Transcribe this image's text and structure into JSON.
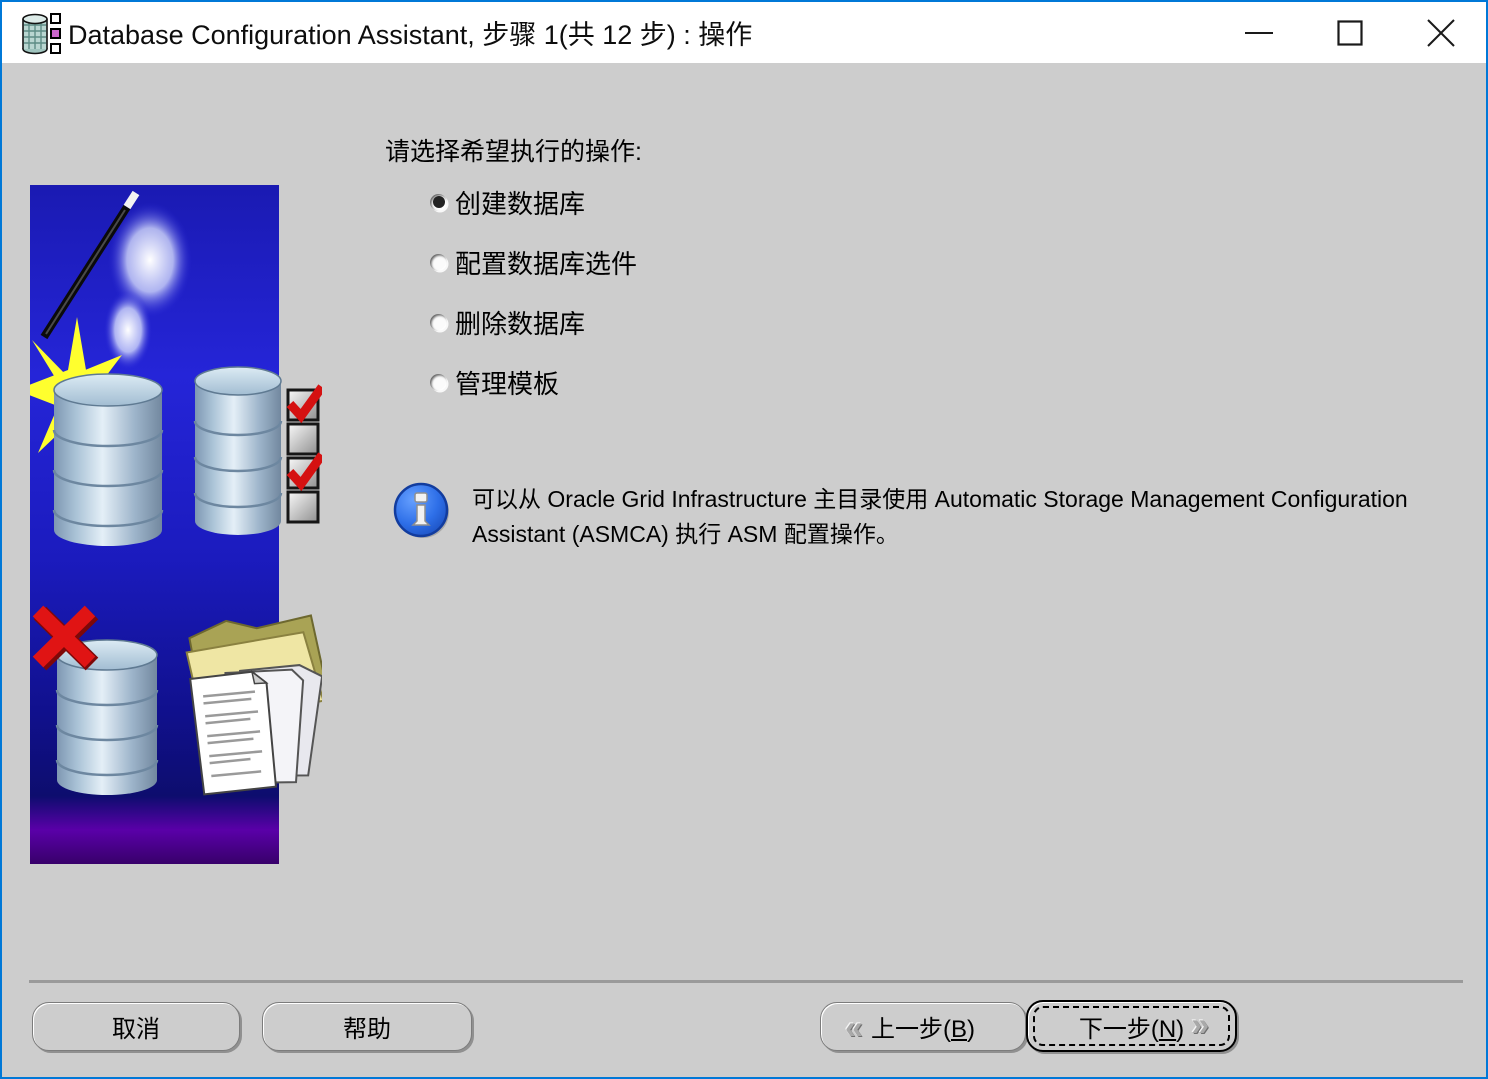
{
  "window": {
    "title": "Database Configuration Assistant, 步骤 1(共 12 步) : 操作",
    "accent_border_color": "#0078d7",
    "background_color": "#cdcdcd",
    "icons": {
      "app_icon": "database-cylinder-with-squares",
      "minimize": "minimize-dash",
      "maximize": "maximize-square",
      "close": "close-x"
    }
  },
  "main": {
    "prompt": "请选择希望执行的操作:",
    "options": [
      {
        "label": "创建数据库",
        "selected": true
      },
      {
        "label": "配置数据库选件",
        "selected": false
      },
      {
        "label": "删除数据库",
        "selected": false
      },
      {
        "label": "管理模板",
        "selected": false
      }
    ],
    "info": {
      "icon": "info-icon",
      "lines": [
        "可以从 Oracle Grid Infrastructure 主目录使用 Automatic Storage Management Configuration",
        "Assistant (ASMCA) 执行 ASM 配置操作。"
      ]
    },
    "sidebar_graphic": "oracle-dbca-wizard-art"
  },
  "footer": {
    "cancel": "取消",
    "help": "帮助",
    "back": {
      "pre": "上一步(",
      "mnemonic": "B",
      "post": ")"
    },
    "next": {
      "pre": "下一步(",
      "mnemonic": "N",
      "post": ")"
    },
    "back_icon": "«",
    "next_icon": "»"
  }
}
